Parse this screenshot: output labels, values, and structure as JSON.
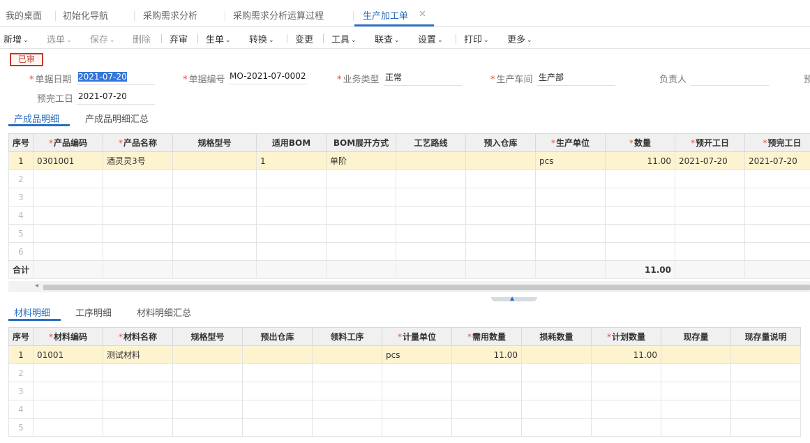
{
  "tabs": [
    "我的桌面",
    "初始化导航",
    "采购需求分析",
    "采购需求分析运算过程",
    "生产加工单"
  ],
  "close_glyph": "✕",
  "toolbar": {
    "new": "新增",
    "select": "选单",
    "save": "保存",
    "delete": "删除",
    "abandon": "弃审",
    "gen": "生单",
    "convert": "转换",
    "change": "变更",
    "tools": "工具",
    "link": "联查",
    "settings": "设置",
    "print": "打印",
    "more": "更多",
    "caret": "⌄"
  },
  "status_badge": "已审",
  "form": {
    "doc_date_label": "单据日期",
    "doc_date": "2021-07-20",
    "doc_no_label": "单据编号",
    "doc_no": "MO-2021-07-0002",
    "biz_type_label": "业务类型",
    "biz_type": "正常",
    "workshop_label": "生产车间",
    "workshop": "生产部",
    "owner_label": "负责人",
    "owner": "",
    "truncated_label": "预",
    "finish_date_label": "预完工日",
    "finish_date": "2021-07-20"
  },
  "product_tabs": [
    "产成品明细",
    "产成品明细汇总"
  ],
  "product_table": {
    "headers": [
      "序号",
      "产品编码",
      "产品名称",
      "规格型号",
      "适用BOM",
      "BOM展开方式",
      "工艺路线",
      "预入仓库",
      "生产单位",
      "数量",
      "预开工日",
      "预完工日"
    ],
    "required": [
      false,
      true,
      true,
      false,
      false,
      false,
      false,
      false,
      true,
      true,
      true,
      true
    ],
    "rows": [
      [
        "1",
        "0301001",
        "酒灵灵3号",
        "",
        "1",
        "单阶",
        "",
        "",
        "pcs",
        "11.00",
        "2021-07-20",
        "2021-07-20"
      ],
      [
        "2",
        "",
        "",
        "",
        "",
        "",
        "",
        "",
        "",
        "",
        "",
        ""
      ],
      [
        "3",
        "",
        "",
        "",
        "",
        "",
        "",
        "",
        "",
        "",
        "",
        ""
      ],
      [
        "4",
        "",
        "",
        "",
        "",
        "",
        "",
        "",
        "",
        "",
        "",
        ""
      ],
      [
        "5",
        "",
        "",
        "",
        "",
        "",
        "",
        "",
        "",
        "",
        "",
        ""
      ],
      [
        "6",
        "",
        "",
        "",
        "",
        "",
        "",
        "",
        "",
        "",
        "",
        ""
      ]
    ],
    "total_label": "合计",
    "total_qty": "11.00"
  },
  "scroll_left_glyph": "◂",
  "splitter_glyph": "▲",
  "material_tabs": [
    "材料明细",
    "工序明细",
    "材料明细汇总"
  ],
  "material_table": {
    "headers": [
      "序号",
      "材料编码",
      "材料名称",
      "规格型号",
      "预出仓库",
      "领料工序",
      "计量单位",
      "需用数量",
      "损耗数量",
      "计划数量",
      "现存量",
      "现存量说明"
    ],
    "required": [
      false,
      true,
      true,
      false,
      false,
      false,
      true,
      true,
      false,
      true,
      false,
      false
    ],
    "rows": [
      [
        "1",
        "01001",
        "测试材料",
        "",
        "",
        "",
        "pcs",
        "11.00",
        "",
        "11.00",
        "",
        ""
      ],
      [
        "2",
        "",
        "",
        "",
        "",
        "",
        "",
        "",
        "",
        "",
        "",
        ""
      ],
      [
        "3",
        "",
        "",
        "",
        "",
        "",
        "",
        "",
        "",
        "",
        "",
        ""
      ],
      [
        "4",
        "",
        "",
        "",
        "",
        "",
        "",
        "",
        "",
        "",
        "",
        ""
      ],
      [
        "5",
        "",
        "",
        "",
        "",
        "",
        "",
        "",
        "",
        "",
        "",
        ""
      ]
    ]
  },
  "colors": {
    "accent": "#2b6ec2",
    "required": "#e74c3c",
    "badge": "#c0392b",
    "selected_row": "#fdf3cf"
  }
}
